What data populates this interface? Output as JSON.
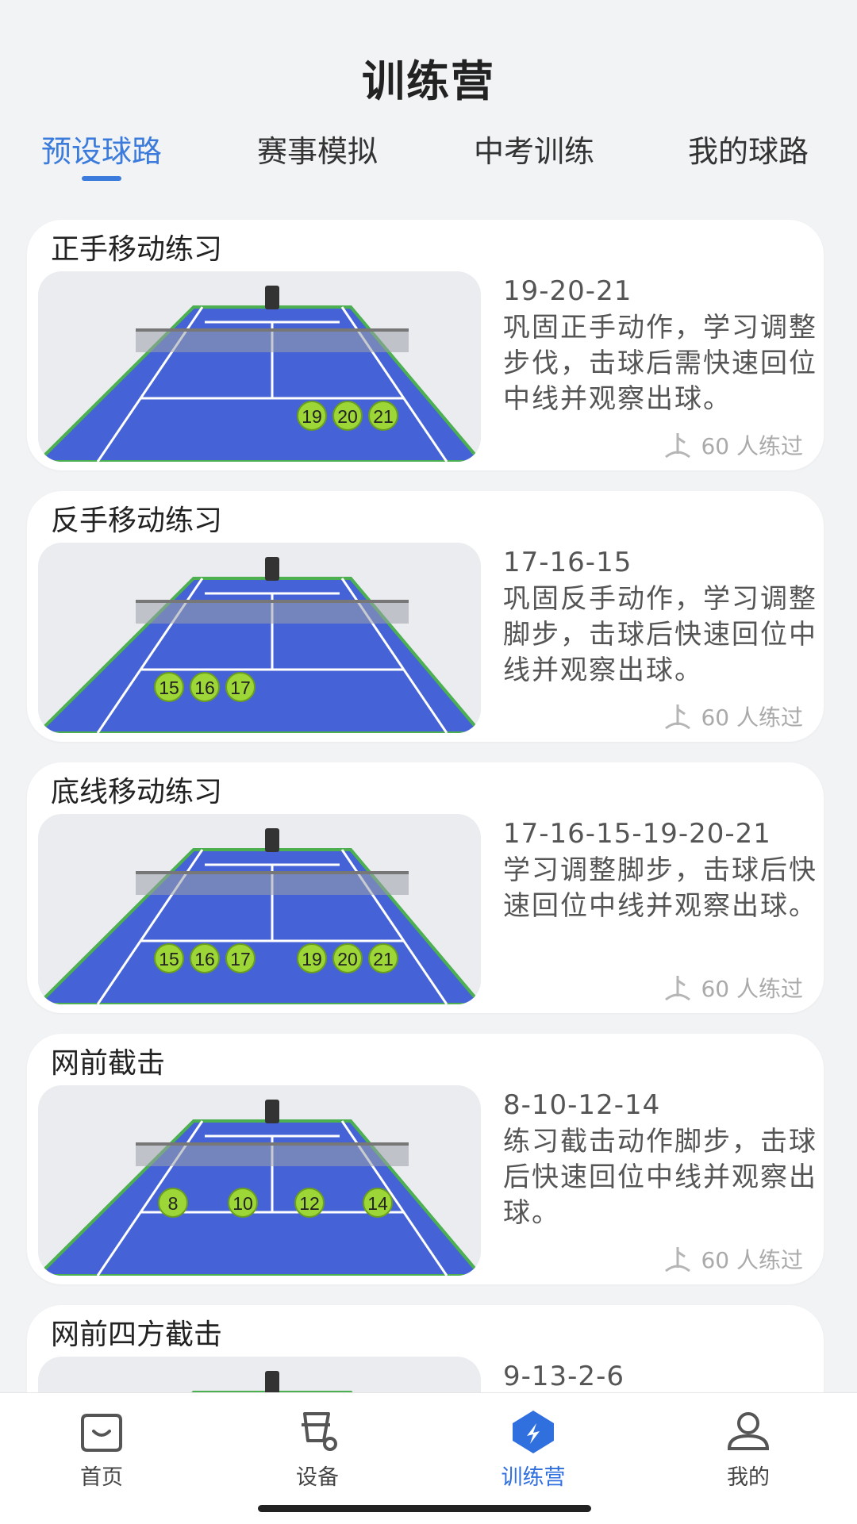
{
  "header": {
    "title": "训练营"
  },
  "tabs": [
    {
      "label": "预设球路",
      "active": true
    },
    {
      "label": "赛事模拟",
      "active": false
    },
    {
      "label": "中考训练",
      "active": false
    },
    {
      "label": "我的球路",
      "active": false
    }
  ],
  "cards": [
    {
      "title": "正手移动练习",
      "route": "19-20-21",
      "description": "巩固正手动作，学习调整步伐，击球后需快速回位中线并观察出球。",
      "practiced": "60 人练过",
      "balls": [
        "19",
        "20",
        "21"
      ]
    },
    {
      "title": "反手移动练习",
      "route": "17-16-15",
      "description": "巩固反手动作，学习调整脚步，击球后快速回位中线并观察出球。",
      "practiced": "60 人练过",
      "balls": [
        "15",
        "16",
        "17"
      ]
    },
    {
      "title": "底线移动练习",
      "route": "17-16-15-19-20-21",
      "description": "学习调整脚步，击球后快速回位中线并观察出球。",
      "practiced": "60 人练过",
      "balls": [
        "15",
        "16",
        "17",
        "19",
        "20",
        "21"
      ]
    },
    {
      "title": "网前截击",
      "route": "8-10-12-14",
      "description": "练习截击动作脚步，击球后快速回位中线并观察出球。",
      "practiced": "60 人练过",
      "balls": [
        "8",
        "10",
        "12",
        "14"
      ]
    },
    {
      "title": "网前四方截击",
      "route": "9-13-2-6",
      "description": "",
      "practiced": "",
      "balls": []
    }
  ],
  "nav": [
    {
      "label": "首页",
      "icon": "home-icon",
      "active": false
    },
    {
      "label": "设备",
      "icon": "device-icon",
      "active": false
    },
    {
      "label": "训练营",
      "icon": "training-camp-icon",
      "active": true
    },
    {
      "label": "我的",
      "icon": "profile-icon",
      "active": false
    }
  ],
  "colors": {
    "accent": "#3a7bdc",
    "court": "#4563d6",
    "court_border": "#4caf50",
    "ball": "#9cd637"
  }
}
